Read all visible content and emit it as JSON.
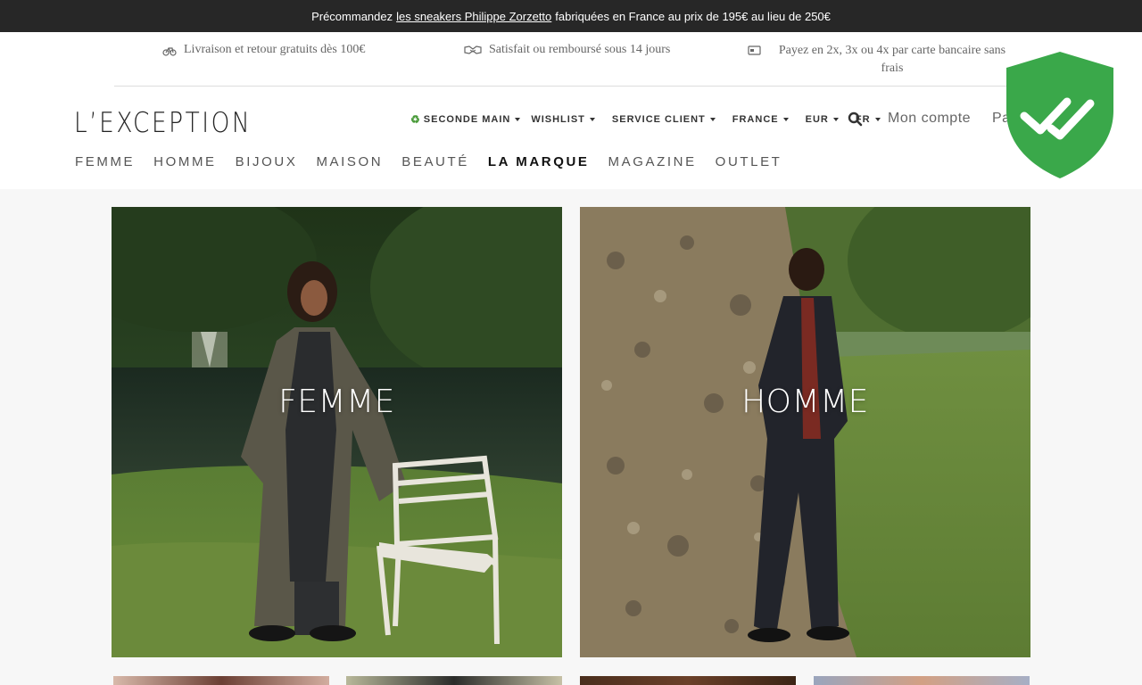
{
  "promo": {
    "before": "Précommandez",
    "link": "les sneakers Philippe Zorzetto",
    "after": "fabriquées en France au prix de 195€ au lieu de 250€"
  },
  "benefits": [
    {
      "icon": "bicycle-icon",
      "text": "Livraison et retour gratuits dès 100€"
    },
    {
      "icon": "handshake-icon",
      "text": "Satisfait ou remboursé sous 14 jours"
    },
    {
      "icon": "credit-card-icon",
      "text": "Payez en 2x, 3x ou 4x par carte bancaire sans frais"
    }
  ],
  "logo": {
    "text": "L’EXCEPTION"
  },
  "utility": {
    "seconde_main": "SECONDE MAIN",
    "wishlist": "WISHLIST",
    "service_client": "SERVICE CLIENT",
    "country": "FRANCE",
    "currency": "EUR",
    "language": "FR",
    "account": "Mon compte",
    "cart": "Panier"
  },
  "nav": [
    {
      "label": "FEMME"
    },
    {
      "label": "HOMME"
    },
    {
      "label": "BIJOUX"
    },
    {
      "label": "MAISON"
    },
    {
      "label": "BEAUTÉ"
    },
    {
      "label": "LA MARQUE",
      "active": true
    },
    {
      "label": "MAGAZINE"
    },
    {
      "label": "OUTLET"
    }
  ],
  "heroes": [
    {
      "label": "FEMME"
    },
    {
      "label": "HOMME"
    }
  ],
  "colors": {
    "promo_bg": "#272727",
    "shield": "#3aa84a",
    "seconde_main_icon": "#4a9b3a"
  }
}
